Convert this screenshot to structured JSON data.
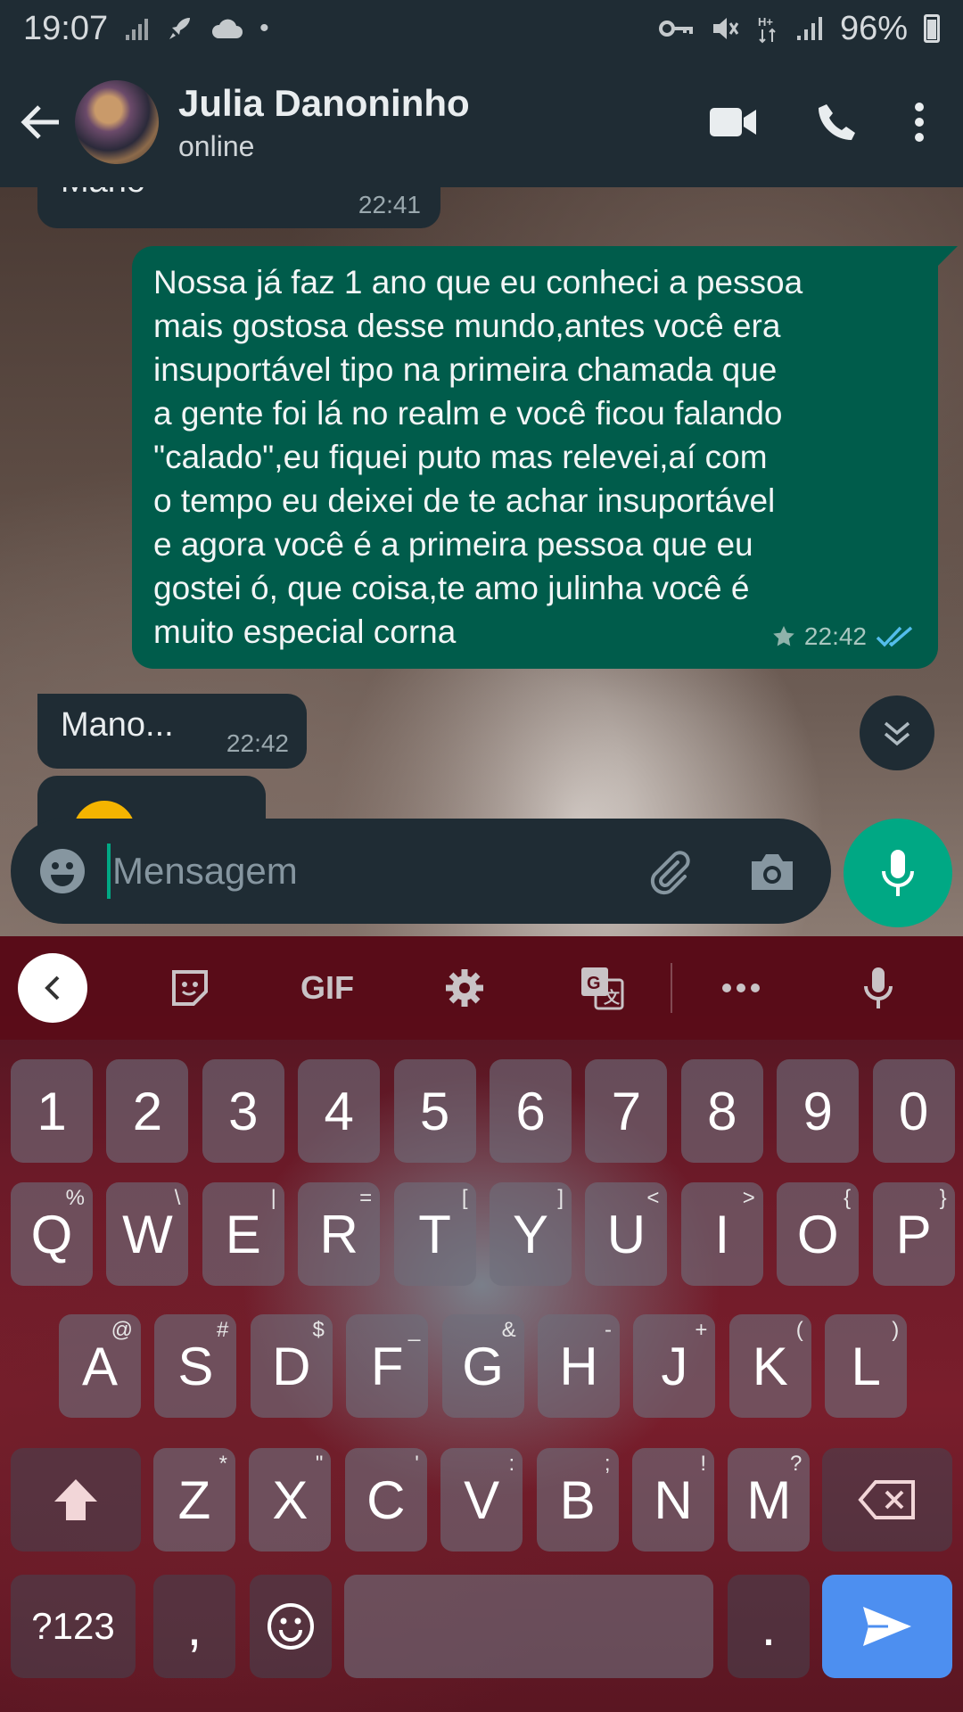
{
  "status_bar": {
    "time": "19:07",
    "battery": "96%"
  },
  "header": {
    "contact_name": "Julia Danoninho",
    "contact_status": "online"
  },
  "chat": {
    "messages": [
      {
        "direction": "in",
        "text": "Mano",
        "time": "22:41"
      },
      {
        "direction": "out",
        "lines": [
          "Nossa já faz 1 ano que eu conheci a pessoa",
          "mais gostosa desse mundo,antes você era",
          "insuportável tipo na primeira chamada que",
          "a gente foi lá no realm e você ficou falando",
          "\"calado\",eu fiquei puto  mas relevei,aí com",
          "o tempo eu deixei de te achar insuportável",
          "e agora você é a primeira pessoa que eu",
          "gostei ó, que coisa,te amo julinha você é",
          "muito especial corna"
        ],
        "time": "22:42",
        "starred": true,
        "read": true
      },
      {
        "direction": "in",
        "text": "Mano...",
        "time": "22:42"
      },
      {
        "direction": "in",
        "text": "",
        "time": ""
      }
    ]
  },
  "composer": {
    "placeholder": "Mensagem"
  },
  "keyboard": {
    "toolbar": {
      "gif_label": "GIF"
    },
    "number_row": [
      "1",
      "2",
      "3",
      "4",
      "5",
      "6",
      "7",
      "8",
      "9",
      "0"
    ],
    "row1": [
      {
        "key": "Q",
        "hint": "%"
      },
      {
        "key": "W",
        "hint": "\\"
      },
      {
        "key": "E",
        "hint": "|"
      },
      {
        "key": "R",
        "hint": "="
      },
      {
        "key": "T",
        "hint": "["
      },
      {
        "key": "Y",
        "hint": "]"
      },
      {
        "key": "U",
        "hint": "<"
      },
      {
        "key": "I",
        "hint": ">"
      },
      {
        "key": "O",
        "hint": "{"
      },
      {
        "key": "P",
        "hint": "}"
      }
    ],
    "row2": [
      {
        "key": "A",
        "hint": "@"
      },
      {
        "key": "S",
        "hint": "#"
      },
      {
        "key": "D",
        "hint": "$"
      },
      {
        "key": "F",
        "hint": "_"
      },
      {
        "key": "G",
        "hint": "&"
      },
      {
        "key": "H",
        "hint": "-"
      },
      {
        "key": "J",
        "hint": "+"
      },
      {
        "key": "K",
        "hint": "("
      },
      {
        "key": "L",
        "hint": ")"
      }
    ],
    "row3": [
      {
        "key": "Z",
        "hint": "*"
      },
      {
        "key": "X",
        "hint": "\""
      },
      {
        "key": "C",
        "hint": "'"
      },
      {
        "key": "V",
        "hint": ":"
      },
      {
        "key": "B",
        "hint": ";"
      },
      {
        "key": "N",
        "hint": "!"
      },
      {
        "key": "M",
        "hint": "?"
      }
    ],
    "bottom": {
      "symbols": "?123",
      "comma": ",",
      "period": "."
    }
  }
}
